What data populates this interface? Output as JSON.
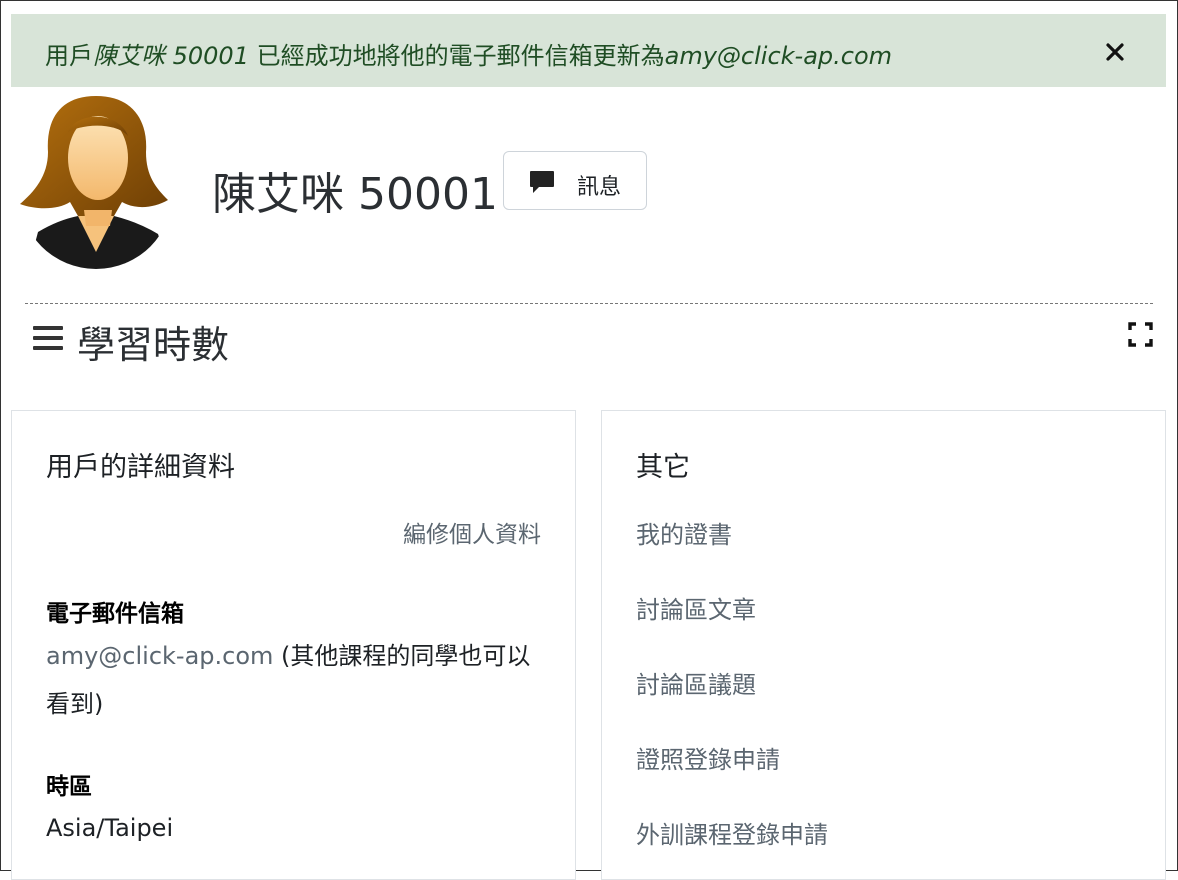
{
  "alert": {
    "prefix": "用戶",
    "user": "陳艾咪 50001",
    "middle": " 已經成功地將他的電子郵件信箱更新為",
    "email": "amy@click-ap.com"
  },
  "profile": {
    "name": "陳艾咪 50001",
    "message_button": "訊息"
  },
  "section": {
    "title": "學習時數"
  },
  "details": {
    "title": "用戶的詳細資料",
    "edit_link": "編修個人資料",
    "email_label": "電子郵件信箱",
    "email_value": "amy@click-ap.com",
    "email_note": " (其他課程的同學也可以看到)",
    "timezone_label": "時區",
    "timezone_value": "Asia/Taipei"
  },
  "other": {
    "title": "其它",
    "links": [
      "我的證書",
      "討論區文章",
      "討論區議題",
      "證照登錄申請",
      "外訓課程登錄申請"
    ]
  },
  "colors": {
    "alert_bg": "#d8e4d8",
    "alert_text": "#1f4d24",
    "link": "#5b6670"
  }
}
